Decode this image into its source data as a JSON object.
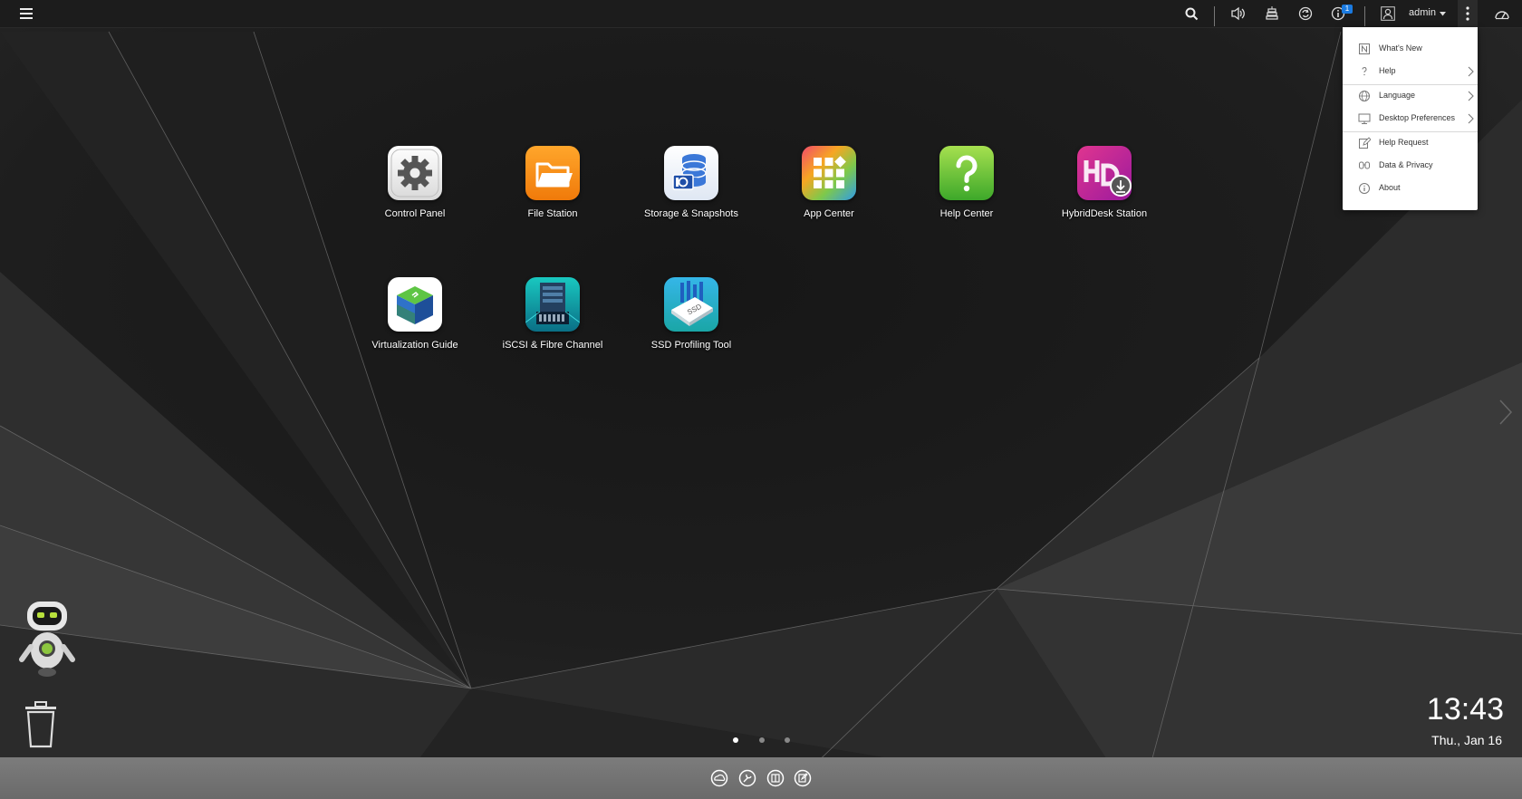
{
  "topbar": {
    "user_name": "admin",
    "notification_count": "1",
    "icons": [
      "menu-icon",
      "search-icon",
      "volume-icon",
      "background-tasks-icon",
      "sync-icon",
      "notification-icon",
      "user-icon",
      "more-options-icon",
      "dashboard-icon"
    ]
  },
  "menu": {
    "items": [
      {
        "label": "What's New",
        "icon": "whats-new-icon",
        "submenu": false
      },
      {
        "label": "Help",
        "icon": "help-icon",
        "submenu": true
      },
      {
        "label": "Language",
        "icon": "globe-icon",
        "submenu": true
      },
      {
        "label": "Desktop Preferences",
        "icon": "monitor-icon",
        "submenu": true
      },
      {
        "label": "Help Request",
        "icon": "edit-icon",
        "submenu": false
      },
      {
        "label": "Data & Privacy",
        "icon": "privacy-icon",
        "submenu": false
      },
      {
        "label": "About",
        "icon": "info-icon",
        "submenu": false
      }
    ]
  },
  "apps": [
    {
      "label": "Control Panel",
      "icon": "gear-icon"
    },
    {
      "label": "File Station",
      "icon": "folder-icon"
    },
    {
      "label": "Storage & Snapshots",
      "icon": "database-icon"
    },
    {
      "label": "App Center",
      "icon": "grid-icon"
    },
    {
      "label": "Help Center",
      "icon": "question-icon"
    },
    {
      "label": "HybridDesk Station",
      "icon": "hd-icon"
    },
    {
      "label": "Virtualization Guide",
      "icon": "cube-icon"
    },
    {
      "label": "iSCSI & Fibre Channel",
      "icon": "server-rack-icon"
    },
    {
      "label": "SSD Profiling Tool",
      "icon": "ssd-icon"
    }
  ],
  "pages": {
    "count": 3,
    "active": 0
  },
  "clock": {
    "time": "13:43",
    "date": "Thu., Jan 16"
  },
  "dock": {
    "icons": [
      "myqnapcloud-icon",
      "tools-icon",
      "multi-window-icon",
      "notes-icon"
    ]
  },
  "colors": {
    "topbar": "#1c1c1c",
    "dock": "#727272",
    "menu_bg": "#ffffff",
    "badge": "#1a7ae0"
  }
}
